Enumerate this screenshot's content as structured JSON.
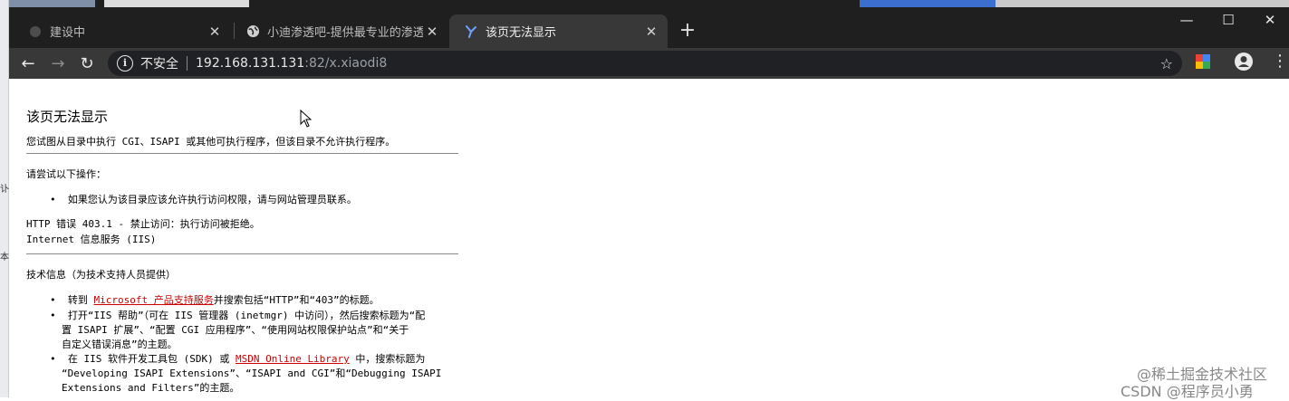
{
  "edge_text": [
    "讣",
    "本"
  ],
  "tabs": [
    {
      "title": "建设中",
      "close": "✕"
    },
    {
      "title": "小迪渗透吧-提供最专业的渗透测",
      "close": "✕"
    },
    {
      "title": "该页无法显示",
      "close": "✕"
    }
  ],
  "new_tab": "+",
  "window_controls": {
    "minimize": "—",
    "maximize": "☐",
    "close": "✕"
  },
  "nav": {
    "back": "←",
    "forward": "→",
    "reload": "↻"
  },
  "address": {
    "security_label": "不安全",
    "host": "192.168.131.131",
    "path": ":82/x.xiaodi8"
  },
  "colors": {
    "tab_strip": "#1f1f1f",
    "toolbar": "#383838",
    "link": "#cc0000"
  },
  "page": {
    "title": "该页无法显示",
    "description": "您试图从目录中执行 CGI、ISAPI 或其他可执行程序，但该目录不允许执行程序。",
    "try_heading": "请尝试以下操作：",
    "try_items": [
      "如果您认为该目录应该允许执行访问权限，请与网站管理员联系。"
    ],
    "error_code": "HTTP 错误 403.1 - 禁止访问：执行访问被拒绝。",
    "server": "Internet 信息服务 (IIS)",
    "tech_heading": "技术信息（为技术支持人员提供）",
    "tech1_pre": "转到 ",
    "tech1_link": "Microsoft 产品支持服务",
    "tech1_post": "并搜索包括“HTTP”和“403”的标题。",
    "tech2_lines": [
      "打开“IIS 帮助”（可在 IIS 管理器 (inetmgr) 中访问），然后搜索标题为“配",
      "置 ISAPI 扩展”、“配置 CGI 应用程序”、“使用网站权限保护站点”和“关于",
      "自定义错误消息”的主题。"
    ],
    "tech3_pre": "在 IIS 软件开发工具包 (SDK) 或 ",
    "tech3_link": "MSDN Online Library",
    "tech3_post": " 中，搜索标题为",
    "tech3_lines": [
      "“Developing ISAPI Extensions”、“ISAPI and CGI”和“Debugging ISAPI",
      "Extensions and Filters”的主题。"
    ]
  },
  "watermarks": [
    "@稀土掘金技术社区",
    "CSDN @程序员小勇"
  ]
}
